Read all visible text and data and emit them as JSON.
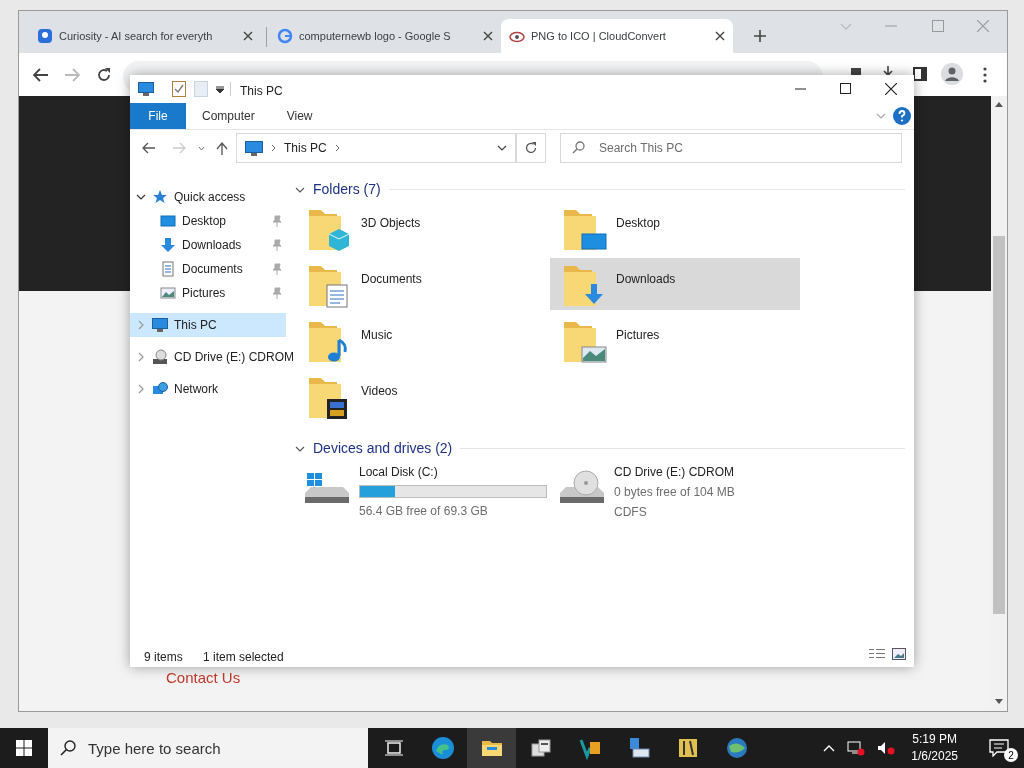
{
  "browser": {
    "tabs": [
      {
        "title": "Curiosity - AI search for everyth",
        "kind": "curiosity",
        "selected": false
      },
      {
        "title": "computernewb logo - Google S",
        "kind": "google",
        "selected": false
      },
      {
        "title": "PNG to ICO | CloudConvert",
        "kind": "cloudconvert",
        "selected": true
      }
    ],
    "page": {
      "link": "Contact Us"
    }
  },
  "explorer": {
    "title": "This PC",
    "ribbon_tabs": [
      {
        "label": "File",
        "kind": "file"
      },
      {
        "label": "Computer",
        "kind": "tab"
      },
      {
        "label": "View",
        "kind": "tab"
      }
    ],
    "address": {
      "path": "This PC"
    },
    "search": {
      "placeholder": "Search This PC"
    },
    "nav": [
      {
        "label": "Quick access",
        "kind": "star",
        "expanded": true,
        "selected": false,
        "children": [
          {
            "label": "Desktop",
            "kind": "desktop",
            "pinned": true
          },
          {
            "label": "Downloads",
            "kind": "downloads",
            "pinned": true
          },
          {
            "label": "Documents",
            "kind": "documents",
            "pinned": true
          },
          {
            "label": "Pictures",
            "kind": "pictures",
            "pinned": true
          }
        ]
      },
      {
        "label": "This PC",
        "kind": "pc",
        "expanded": false,
        "selected": true
      },
      {
        "label": "CD Drive (E:) CDROM",
        "kind": "cd",
        "expanded": false,
        "selected": false
      },
      {
        "label": "Network",
        "kind": "network",
        "expanded": false,
        "selected": false
      }
    ],
    "folders": {
      "title": "Folders (7)",
      "items": [
        {
          "name": "3D Objects",
          "kind": "cube",
          "selected": false
        },
        {
          "name": "Desktop",
          "kind": "desktop",
          "selected": false
        },
        {
          "name": "Documents",
          "kind": "documents",
          "selected": false
        },
        {
          "name": "Downloads",
          "kind": "downloads",
          "selected": true
        },
        {
          "name": "Music",
          "kind": "music",
          "selected": false
        },
        {
          "name": "Pictures",
          "kind": "pictures",
          "selected": false
        },
        {
          "name": "Videos",
          "kind": "videos",
          "selected": false
        }
      ]
    },
    "drives": {
      "title": "Devices and drives (2)",
      "items": [
        {
          "name": "Local Disk (C:)",
          "kind": "hdd",
          "level": 0.19,
          "info": "56.4 GB free of 69.3 GB"
        },
        {
          "name": "CD Drive (E:) CDROM",
          "kind": "cd",
          "info": "0 bytes free of 104 MB",
          "filesystem": "CDFS"
        }
      ]
    },
    "status": {
      "count": "9 items",
      "selection": "1 item selected"
    }
  },
  "taskbar": {
    "search_placeholder": "Type here to search",
    "apps": [
      {
        "kind": "edge",
        "selected": false
      },
      {
        "kind": "explorer",
        "selected": true
      },
      {
        "kind": "server",
        "selected": false
      },
      {
        "kind": "studio",
        "selected": false
      },
      {
        "kind": "network",
        "selected": false
      },
      {
        "kind": "tool",
        "selected": false
      },
      {
        "kind": "globe",
        "selected": false
      }
    ],
    "time": "5:19 PM",
    "date": "1/6/2025",
    "notifications": "2"
  }
}
